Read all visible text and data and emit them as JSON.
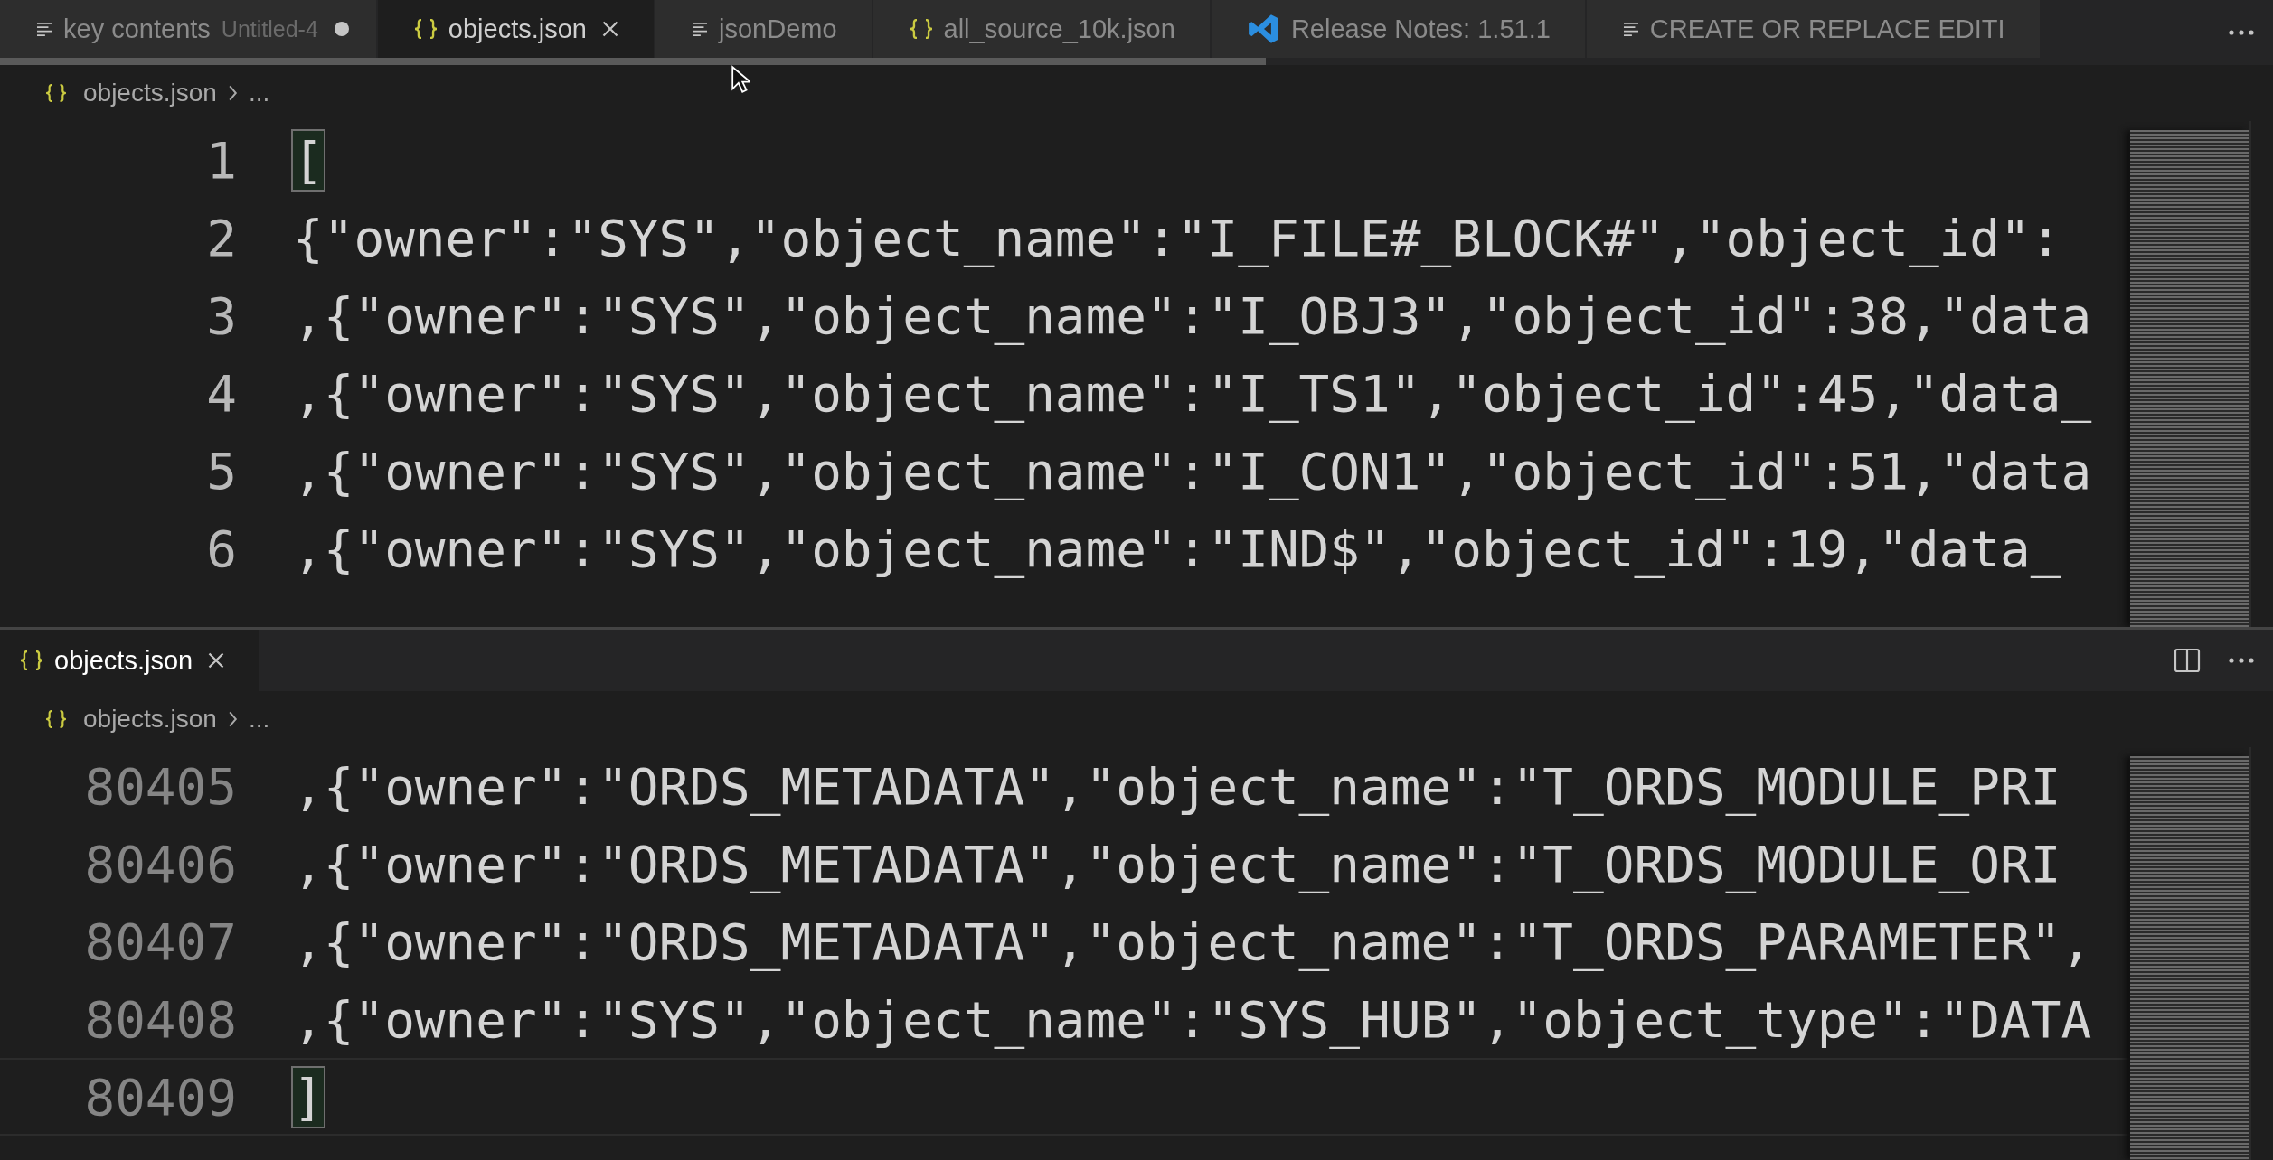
{
  "tabs": [
    {
      "kind": "lines",
      "label": "key contents",
      "description": "Untitled-4",
      "dirty": true,
      "selected": false
    },
    {
      "kind": "braces",
      "label": "objects.json",
      "dirty": false,
      "selected": true
    },
    {
      "kind": "lines",
      "label": "jsonDemo",
      "dirty": false,
      "selected": false
    },
    {
      "kind": "braces",
      "label": "all_source_10k.json",
      "dirty": false,
      "selected": false
    },
    {
      "kind": "vscode",
      "label": "Release Notes: 1.51.1",
      "dirty": false,
      "selected": false
    },
    {
      "kind": "lines",
      "label": "CREATE OR REPLACE EDITI",
      "dirty": false,
      "selected": false
    }
  ],
  "groups": [
    {
      "breadcrumb": {
        "file": "objects.json",
        "rest": "..."
      },
      "lines": [
        {
          "number": "1",
          "text": "[",
          "bracket_match": true,
          "current": false
        },
        {
          "number": "2",
          "text": "{\"owner\":\"SYS\",\"object_name\":\"I_FILE#_BLOCK#\",\"object_id\":",
          "bracket_match": false,
          "current": false
        },
        {
          "number": "3",
          "text": ",{\"owner\":\"SYS\",\"object_name\":\"I_OBJ3\",\"object_id\":38,\"data",
          "bracket_match": false,
          "current": false
        },
        {
          "number": "4",
          "text": ",{\"owner\":\"SYS\",\"object_name\":\"I_TS1\",\"object_id\":45,\"data_",
          "bracket_match": false,
          "current": false
        },
        {
          "number": "5",
          "text": ",{\"owner\":\"SYS\",\"object_name\":\"I_CON1\",\"object_id\":51,\"data",
          "bracket_match": false,
          "current": false
        },
        {
          "number": "6",
          "text": ",{\"owner\":\"SYS\",\"object_name\":\"IND$\",\"object_id\":19,\"data_",
          "bracket_match": false,
          "current": false
        }
      ]
    },
    {
      "tabs": [
        {
          "kind": "braces",
          "label": "objects.json",
          "dirty": false,
          "selected": true
        }
      ],
      "breadcrumb": {
        "file": "objects.json",
        "rest": "..."
      },
      "lines": [
        {
          "number": "80405",
          "text": ",{\"owner\":\"ORDS_METADATA\",\"object_name\":\"T_ORDS_MODULE_PRI",
          "bracket_match": false,
          "current": false
        },
        {
          "number": "80406",
          "text": ",{\"owner\":\"ORDS_METADATA\",\"object_name\":\"T_ORDS_MODULE_ORI",
          "bracket_match": false,
          "current": false
        },
        {
          "number": "80407",
          "text": ",{\"owner\":\"ORDS_METADATA\",\"object_name\":\"T_ORDS_PARAMETER\",",
          "bracket_match": false,
          "current": false
        },
        {
          "number": "80408",
          "text": ",{\"owner\":\"SYS\",\"object_name\":\"SYS_HUB\",\"object_type\":\"DATA",
          "bracket_match": false,
          "current": false
        },
        {
          "number": "80409",
          "text": "]",
          "bracket_match": true,
          "current": true
        }
      ]
    }
  ]
}
